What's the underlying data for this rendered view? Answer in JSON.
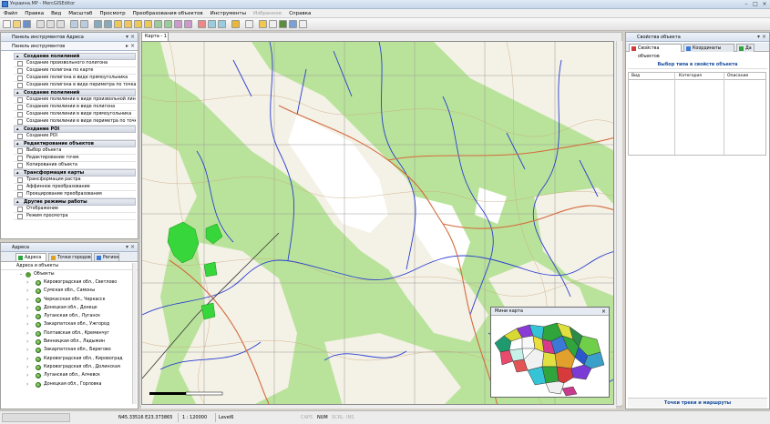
{
  "window": {
    "title": "Украина.MP - MercGISEditor"
  },
  "menu": [
    {
      "label": "Файл",
      "enabled": true
    },
    {
      "label": "Правка",
      "enabled": true
    },
    {
      "label": "Вид",
      "enabled": true
    },
    {
      "label": "Масштаб",
      "enabled": true
    },
    {
      "label": "Просмотр",
      "enabled": true
    },
    {
      "label": "Преобразования объектов",
      "enabled": true
    },
    {
      "label": "Инструменты",
      "enabled": true
    },
    {
      "label": "Избранное",
      "enabled": false
    },
    {
      "label": "Справка",
      "enabled": true
    }
  ],
  "tools_panel": {
    "title": "Панель инструментов Адреса",
    "subtitle": "Панель инструментов",
    "sections": [
      {
        "title": "Создание полилиний",
        "items": [
          "Создание произвольного полигона",
          "Создание полигона по карте",
          "Создание полигона в виде прямоугольника",
          "Создание полигона в виде периметра по точкам"
        ]
      },
      {
        "title": "Создание полилиний",
        "items": [
          "Создание полилинии в виде произвольной линии",
          "Создание полилинии в виде полигона",
          "Создание полилинии в виде прямоугольника",
          "Создание полилинии в виде периметра по точкам"
        ]
      },
      {
        "title": "Создание POI",
        "items": [
          "Создание POI"
        ]
      },
      {
        "title": "Редактирование объектов",
        "items": [
          "Выбор объекта",
          "Редактирование точек",
          "Копирование объекта"
        ]
      },
      {
        "title": "Трансформация карты",
        "items": [
          "Трансформация растра",
          "Аффинное преобразование",
          "Проецирование преобразования"
        ]
      },
      {
        "title": "Другие режимы работы",
        "items": [
          "Отображение",
          "Режим просмотра"
        ]
      }
    ]
  },
  "address_panel": {
    "title": "Адреса",
    "tabs": [
      "Адреса",
      "Точки городов",
      "Регион"
    ],
    "root_label": "Адреса и объекты",
    "root_node": "Объекты",
    "rows": [
      "Кировоградская обл., Светлово",
      "Сумская обл., Самоны",
      "Черкасская обл., Черкасск",
      "Донецкая обл., Донецк",
      "Луганская обл., Луганск",
      "Закарпатская обл., Ужгород",
      "Полтавская обл., Кременчуг",
      "Винницкая обл., Ладыжин",
      "Закарпатская обл., Берегово",
      "Кировоградская обл., Кировоград",
      "Кировоградская обл., Долинская",
      "Луганская обл., Алчевск",
      "Донецкая обл., Горловка"
    ]
  },
  "map": {
    "tab_label": "Карта - 1",
    "overview_title": "Мини карта"
  },
  "properties_panel": {
    "title": "Свойства объекта",
    "tabs": [
      "Свойства объектов",
      "Координаты",
      "Да"
    ],
    "heading": "Выбор типа в свойств объекта",
    "columns": [
      "Вид",
      "Категория",
      "Описание"
    ],
    "footer_button": "Точки треки и маршруты"
  },
  "status": {
    "coords": "N45.33516 E23.373865",
    "scale": "1 : 120000",
    "level": "Level6",
    "caps": "CAPS",
    "num": "NUM",
    "scrl": "SCRL",
    "ins": "INS"
  },
  "colors": {
    "forest": "#b9e39a",
    "clearing": "#ffffff",
    "river": "#2a3fd1",
    "road": "#d46a3d",
    "contour": "#c9a67a",
    "selection": "#37d63a"
  }
}
